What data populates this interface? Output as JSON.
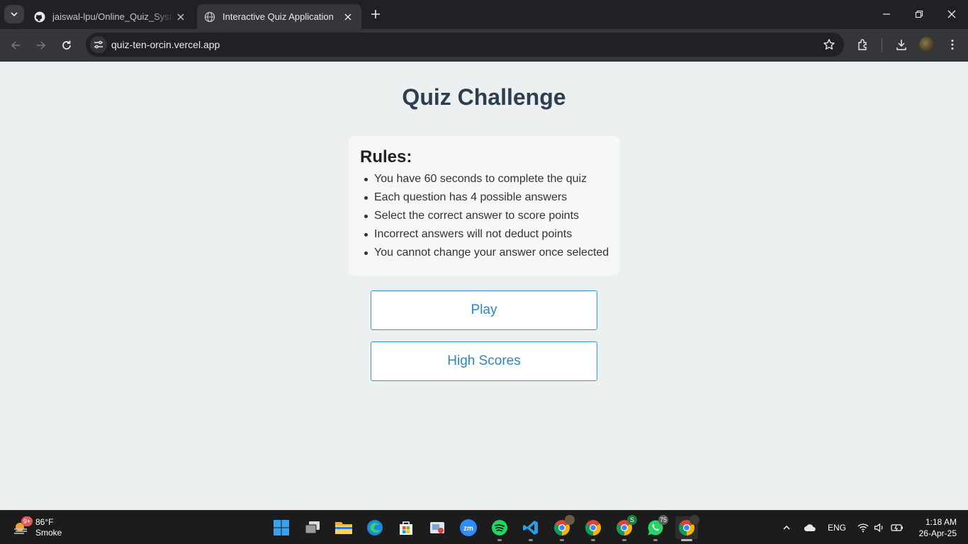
{
  "browser": {
    "tabs": [
      {
        "title": "jaiswal-lpu/Online_Quiz_System"
      },
      {
        "title": "Interactive Quiz Application"
      }
    ],
    "url": "quiz-ten-orcin.vercel.app"
  },
  "page": {
    "title": "Quiz Challenge",
    "rules_heading": "Rules:",
    "rules": [
      "You have 60 seconds to complete the quiz",
      "Each question has 4 possible answers",
      "Select the correct answer to score points",
      "Incorrect answers will not deduct points",
      "You cannot change your answer once selected"
    ],
    "play_label": "Play",
    "high_scores_label": "High Scores"
  },
  "taskbar": {
    "weather": {
      "badge": "9+",
      "temp": "86°F",
      "condition": "Smoke"
    },
    "badges": {
      "chrome_green": "S",
      "whatsapp": "75"
    },
    "language": "ENG",
    "time": "1:18 AM",
    "date": "26-Apr-25"
  }
}
